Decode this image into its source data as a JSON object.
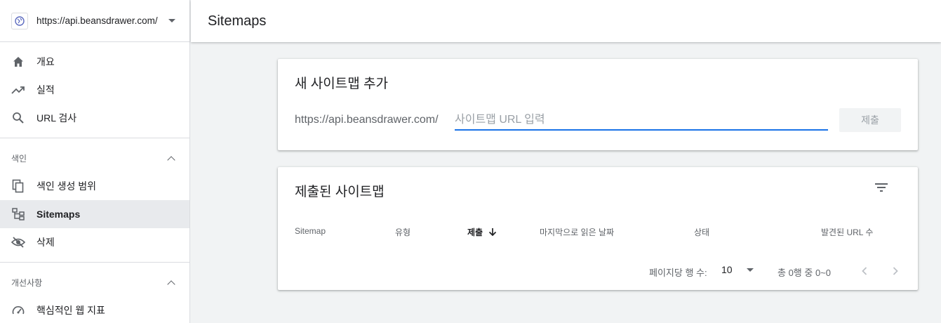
{
  "property": {
    "url": "https://api.beansdrawer.com/"
  },
  "sidebar": {
    "top_items": [
      {
        "label": "개요",
        "icon": "home-icon"
      },
      {
        "label": "실적",
        "icon": "trending-up-icon"
      },
      {
        "label": "URL 검사",
        "icon": "search-icon"
      }
    ],
    "index_section": {
      "title": "색인",
      "items": [
        {
          "label": "색인 생성 범위",
          "icon": "copy-icon"
        },
        {
          "label": "Sitemaps",
          "icon": "sitemap-icon",
          "active": true
        },
        {
          "label": "삭제",
          "icon": "eye-off-icon"
        }
      ]
    },
    "enhancements_section": {
      "title": "개선사항",
      "items": [
        {
          "label": "핵심적인 웹 지표",
          "icon": "speed-icon"
        }
      ]
    }
  },
  "header": {
    "title": "Sitemaps"
  },
  "add_card": {
    "title": "새 사이트맵 추가",
    "url_prefix": "https://api.beansdrawer.com/",
    "input_placeholder": "사이트맵 URL 입력",
    "input_value": "",
    "submit_label": "제출"
  },
  "submitted_card": {
    "title": "제출된 사이트맵",
    "columns": [
      "Sitemap",
      "유형",
      "제출",
      "마지막으로 읽은 날짜",
      "상태",
      "발견된 URL 수"
    ],
    "sorted_column": "제출",
    "rows_per_page_label": "페이지당 행 수:",
    "rows_per_page_value": "10",
    "range_label": "총 0행 중 0~0"
  },
  "colors": {
    "accent": "#1a73e8",
    "active_bg": "#e8eaed",
    "text": "#202124",
    "muted": "#5f6368"
  }
}
